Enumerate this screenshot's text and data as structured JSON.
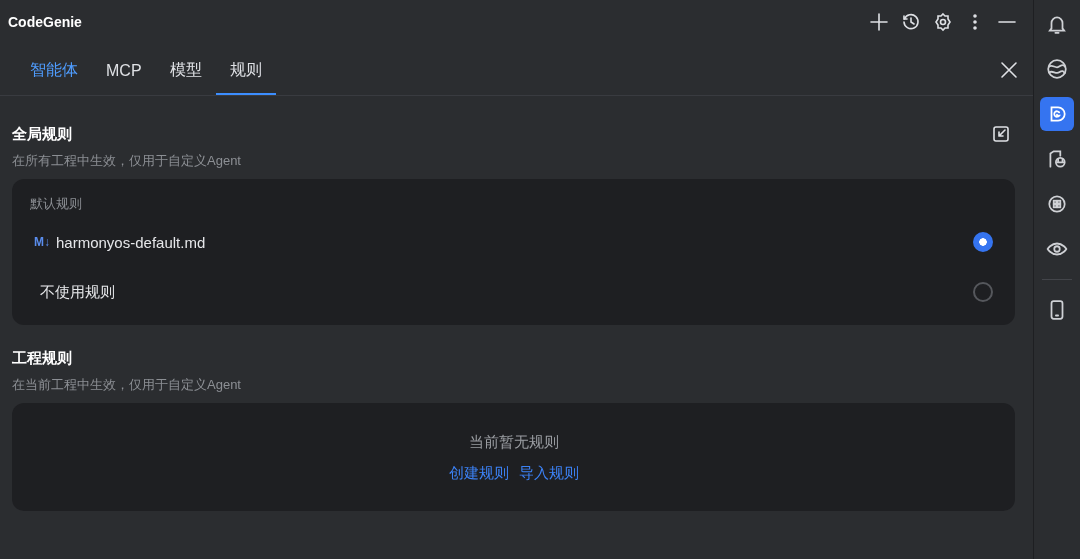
{
  "window": {
    "title": "CodeGenie"
  },
  "tabs": [
    {
      "label": "智能体",
      "selected": false,
      "hovered": true
    },
    {
      "label": "MCP",
      "selected": false,
      "hovered": false
    },
    {
      "label": "模型",
      "selected": false,
      "hovered": false
    },
    {
      "label": "规则",
      "selected": true,
      "hovered": false
    }
  ],
  "global_rules": {
    "heading": "全局规则",
    "description": "在所有工程中生效，仅用于自定义Agent",
    "group_label": "默认规则",
    "options": [
      {
        "kind": "markdown",
        "badge": "M↓",
        "label": "harmonyos-default.md",
        "selected": true
      },
      {
        "kind": "plain",
        "label": "不使用规则",
        "selected": false
      }
    ]
  },
  "project_rules": {
    "heading": "工程规则",
    "description": "在当前工程中生效，仅用于自定义Agent",
    "empty_text": "当前暂无规则",
    "links": [
      "创建规则",
      "导入规则"
    ]
  },
  "sidebar": {
    "items": [
      {
        "selected": false
      },
      {
        "selected": false
      },
      {
        "selected": true
      },
      {
        "selected": false
      },
      {
        "selected": false
      },
      {
        "selected": false
      },
      {
        "selected": false
      }
    ]
  }
}
